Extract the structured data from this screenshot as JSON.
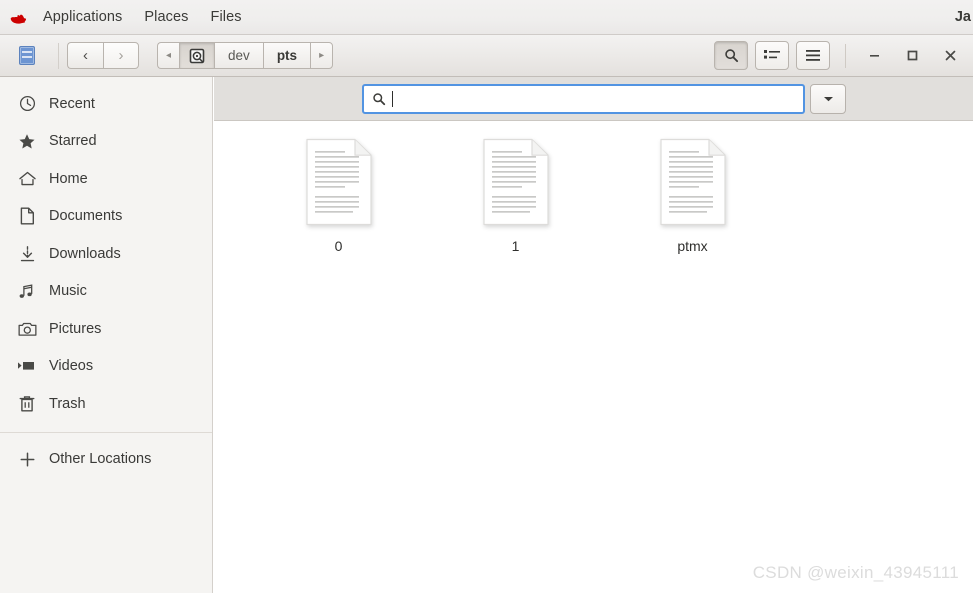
{
  "topbar": {
    "logo_icon": "red-hat-logo",
    "items": [
      {
        "label": "Applications"
      },
      {
        "label": "Places"
      },
      {
        "label": "Files"
      }
    ],
    "clock": "Ja"
  },
  "headerbar": {
    "sidebar_toggle_icon": "blue-document-icon",
    "nav": {
      "back_icon": "chevron-left-icon",
      "back_label": "‹",
      "forward_icon": "chevron-right-icon",
      "forward_label": "›"
    },
    "breadcrumb": {
      "prev_label": "◂",
      "next_label": "▸",
      "items": [
        {
          "label": "",
          "icon": "drive-filesystem-icon",
          "current": false
        },
        {
          "label": "dev",
          "icon": "",
          "current": false
        },
        {
          "label": "pts",
          "icon": "",
          "current": true
        }
      ]
    },
    "tools": [
      {
        "name": "search-toggle-button",
        "icon": "search-icon"
      },
      {
        "name": "view-list-button",
        "icon": "list-view-icon"
      },
      {
        "name": "menu-button",
        "icon": "hamburger-menu-icon"
      }
    ],
    "window_controls": [
      {
        "name": "minimize-button",
        "icon": "minimize-icon",
        "glyph": "–"
      },
      {
        "name": "maximize-button",
        "icon": "maximize-icon",
        "glyph": "□"
      },
      {
        "name": "close-button",
        "icon": "close-icon",
        "glyph": "×"
      }
    ]
  },
  "sidebar": {
    "items": [
      {
        "label": "Recent",
        "icon": "clock-icon"
      },
      {
        "label": "Starred",
        "icon": "star-icon"
      },
      {
        "label": "Home",
        "icon": "home-icon"
      },
      {
        "label": "Documents",
        "icon": "document-icon"
      },
      {
        "label": "Downloads",
        "icon": "download-icon"
      },
      {
        "label": "Music",
        "icon": "music-note-icon"
      },
      {
        "label": "Pictures",
        "icon": "camera-icon"
      },
      {
        "label": "Videos",
        "icon": "video-icon"
      },
      {
        "label": "Trash",
        "icon": "trash-icon"
      }
    ],
    "other_locations": {
      "label": "Other Locations",
      "icon": "plus-icon"
    }
  },
  "search": {
    "value": "",
    "placeholder": "",
    "icon": "search-icon",
    "dropdown_icon": "chevron-down-icon"
  },
  "files": [
    {
      "name": "0",
      "icon": "text-document-icon"
    },
    {
      "name": "1",
      "icon": "text-document-icon"
    },
    {
      "name": "ptmx",
      "icon": "text-document-icon"
    }
  ],
  "watermark": {
    "text": "CSDN @weixin_43945111"
  },
  "colors": {
    "accent_blue": "#5294e2",
    "topbar_bg": "#efeeed",
    "sidebar_bg": "#f5f4f2",
    "searchbar_bg": "#e1dfdc",
    "content_bg": "#ffffff",
    "logo_red": "#cc0000"
  }
}
